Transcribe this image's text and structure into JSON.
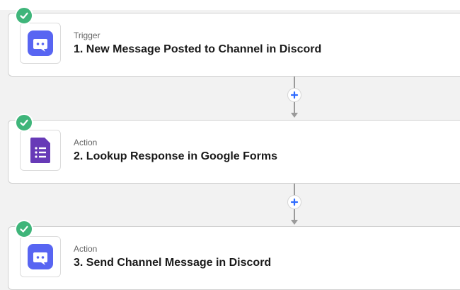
{
  "colors": {
    "discord": "#5865f2",
    "google_forms": "#673ab7",
    "success": "#3fb57a",
    "add_button": "#2f6bff"
  },
  "steps": [
    {
      "kind": "Trigger",
      "title": "1. New Message Posted to Channel in Discord",
      "app_icon": "discord-icon",
      "status_icon": "check-icon"
    },
    {
      "kind": "Action",
      "title": "2. Lookup Response in Google Forms",
      "app_icon": "google-forms-icon",
      "status_icon": "check-icon"
    },
    {
      "kind": "Action",
      "title": "3. Send Channel Message in Discord",
      "app_icon": "discord-icon",
      "status_icon": "check-icon"
    }
  ],
  "connectors": [
    {
      "button_icon": "plus-icon"
    },
    {
      "button_icon": "plus-icon"
    }
  ]
}
